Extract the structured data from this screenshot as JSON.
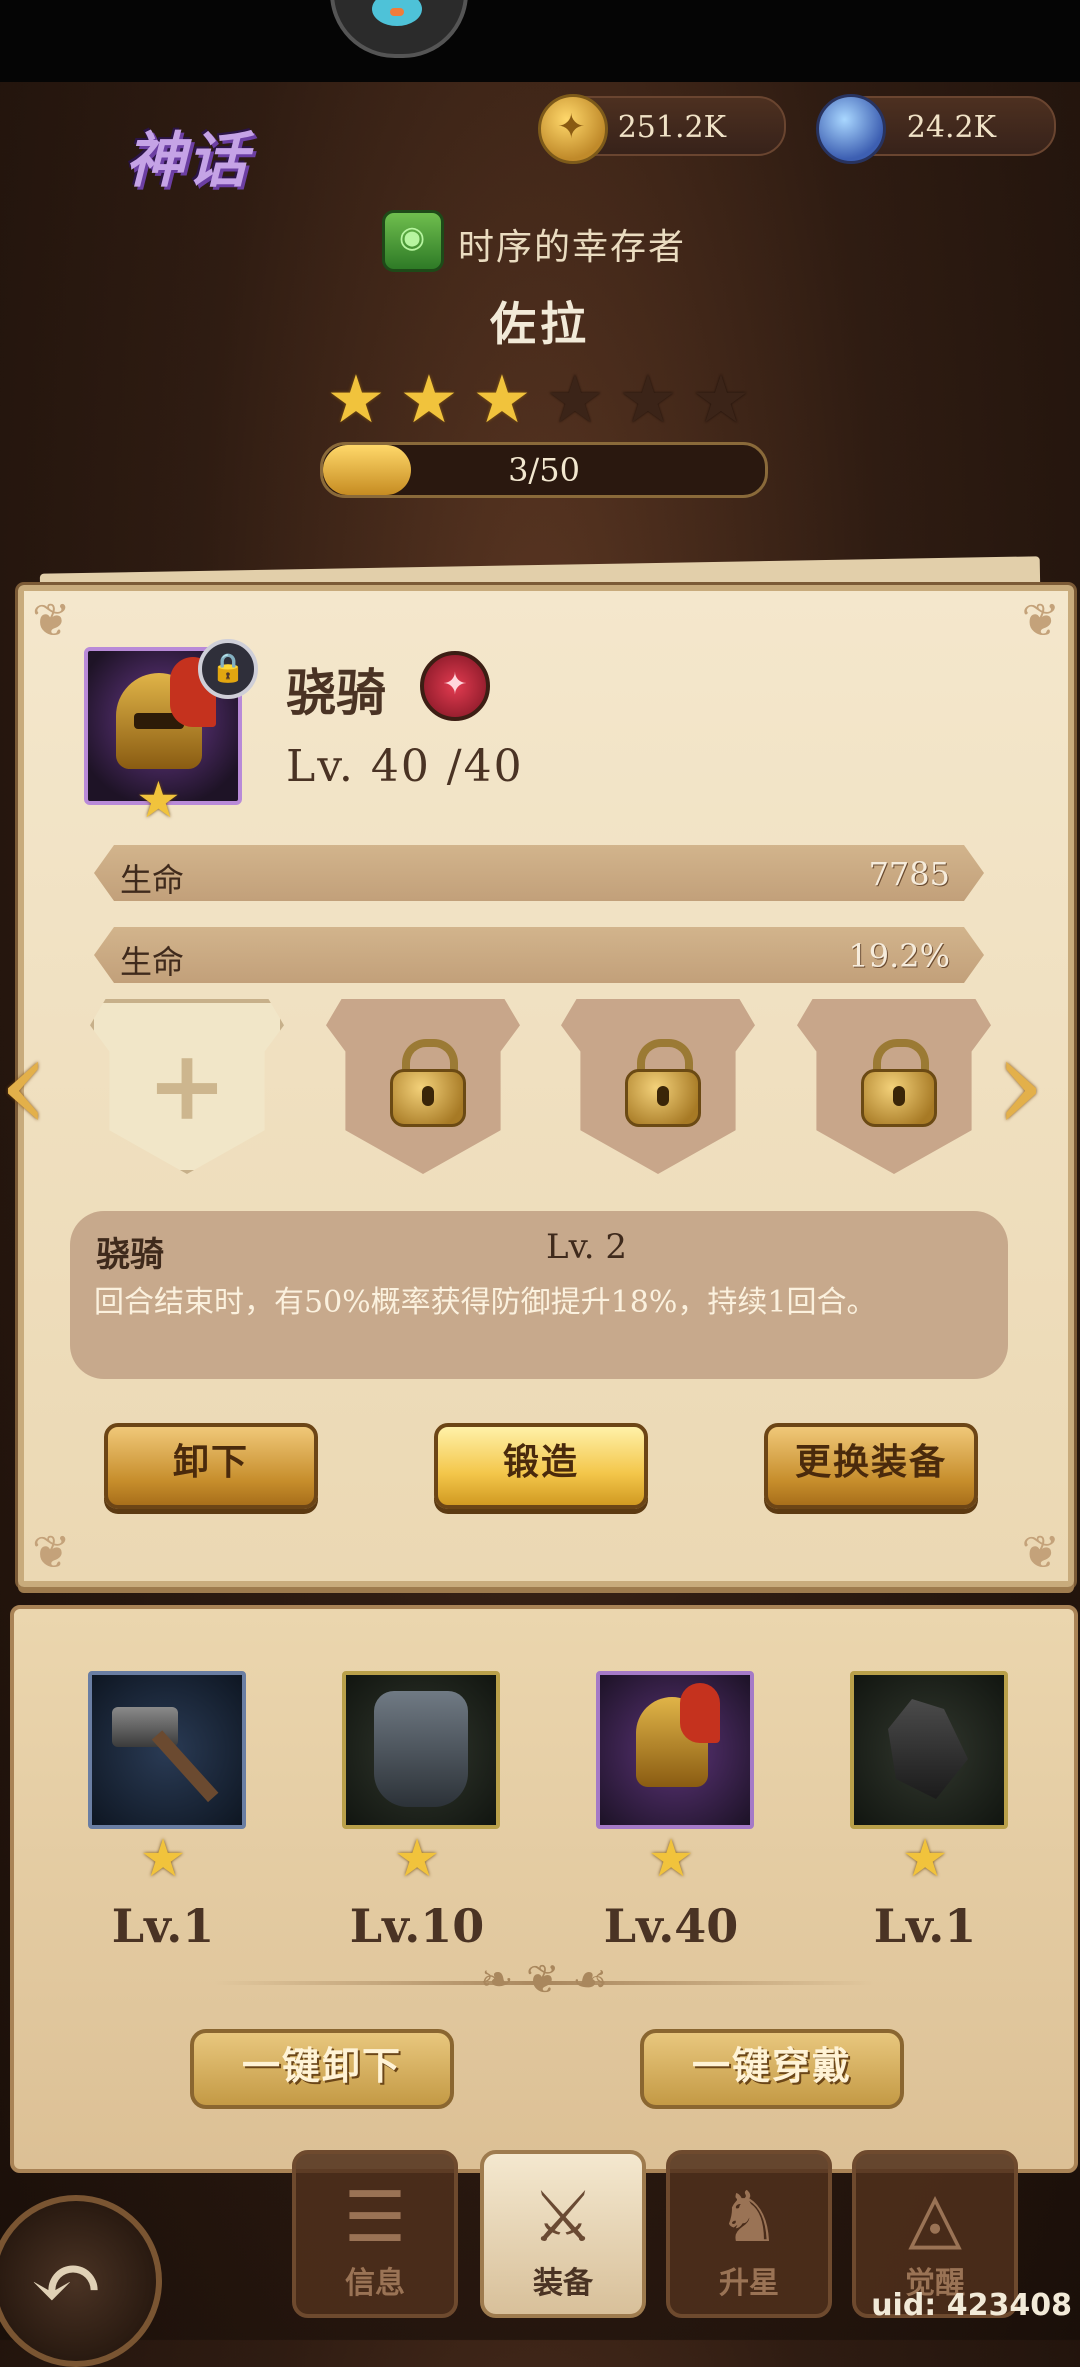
{
  "hero": {
    "rarity": "神话",
    "faction": "时序的幸存者",
    "name": "佐拉",
    "stars_filled": 3,
    "stars_total": 6,
    "star_progress_text": "3/50",
    "star_progress_fraction": 0.06
  },
  "currencies": [
    {
      "icon": "coin-icon",
      "amount": "251.2K"
    },
    {
      "icon": "gem-icon",
      "amount": "24.2K"
    }
  ],
  "equipment_detail": {
    "name": "骁骑",
    "level": "Lv. 40 /40",
    "stats": [
      {
        "label": "生命",
        "value": "7785"
      },
      {
        "label": "生命",
        "value": "19.2%"
      }
    ],
    "sockets": [
      "empty",
      "locked",
      "locked",
      "locked"
    ],
    "skill": {
      "name": "骁骑",
      "level": "Lv. 2",
      "description": "回合结束时，有50%概率获得防御提升18%，持续1回合。"
    },
    "buttons": {
      "unequip": "卸下",
      "forge": "锻造",
      "replace": "更换装备"
    }
  },
  "equipped": [
    {
      "item": "hammer",
      "stars": 1,
      "level": "Lv.1"
    },
    {
      "item": "armor",
      "stars": 1,
      "level": "Lv.10"
    },
    {
      "item": "helmet",
      "stars": 1,
      "level": "Lv.40"
    },
    {
      "item": "crystal",
      "stars": 1,
      "level": "Lv.1"
    }
  ],
  "bulk_actions": {
    "unequip_all": "一键卸下",
    "equip_all": "一键穿戴"
  },
  "nav": [
    {
      "label": "信息",
      "icon": "info-icon",
      "active": false
    },
    {
      "label": "装备",
      "icon": "equipment-icon",
      "active": true
    },
    {
      "label": "升星",
      "icon": "star-up-icon",
      "active": false
    },
    {
      "label": "觉醒",
      "icon": "awaken-icon",
      "active": false
    }
  ],
  "uid": "uid: 423408",
  "colors": {
    "accent_gold": "#f1c33c",
    "panel": "#f4e7cc",
    "background": "#2f1c12"
  }
}
